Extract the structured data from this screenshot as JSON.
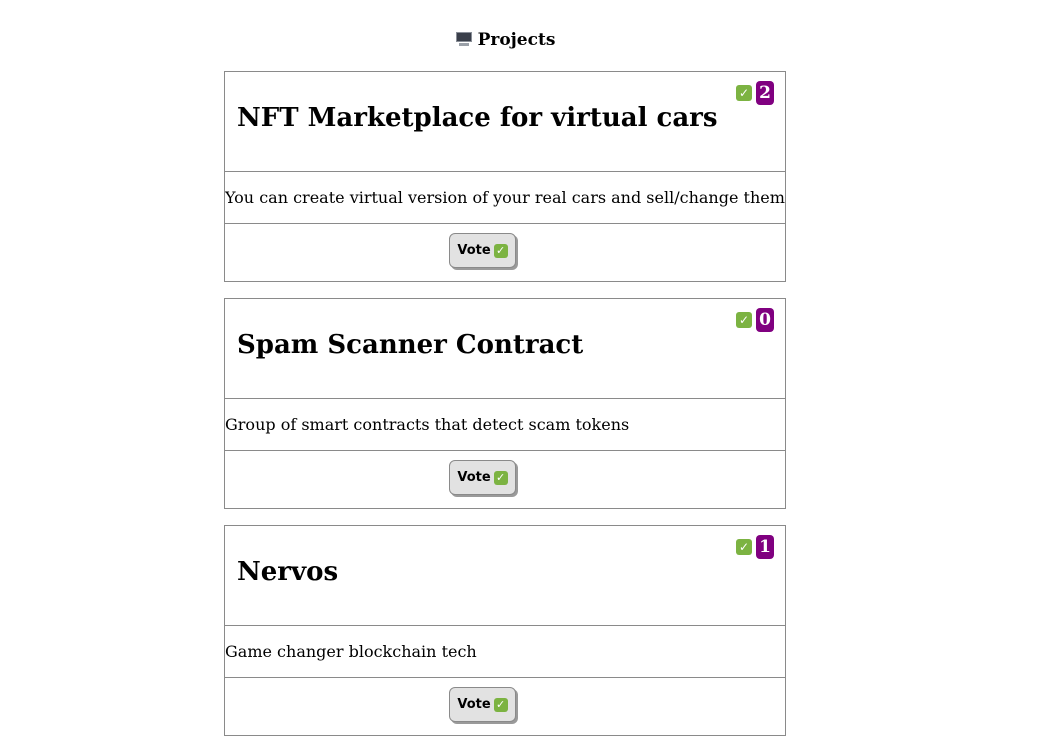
{
  "header": {
    "icon": "desktop-computer-icon",
    "title": "Projects"
  },
  "colors": {
    "badge": "#800080",
    "check": "#7cb342"
  },
  "projects": [
    {
      "title": "NFT Marketplace for virtual cars",
      "votes": "2",
      "description": "You can create virtual version of your real cars and sell/change them",
      "vote_label": "Vote"
    },
    {
      "title": "Spam Scanner Contract",
      "votes": "0",
      "description": "Group of smart contracts that detect scam tokens",
      "vote_label": "Vote"
    },
    {
      "title": "Nervos",
      "votes": "1",
      "description": "Game changer blockchain tech",
      "vote_label": "Vote"
    }
  ]
}
